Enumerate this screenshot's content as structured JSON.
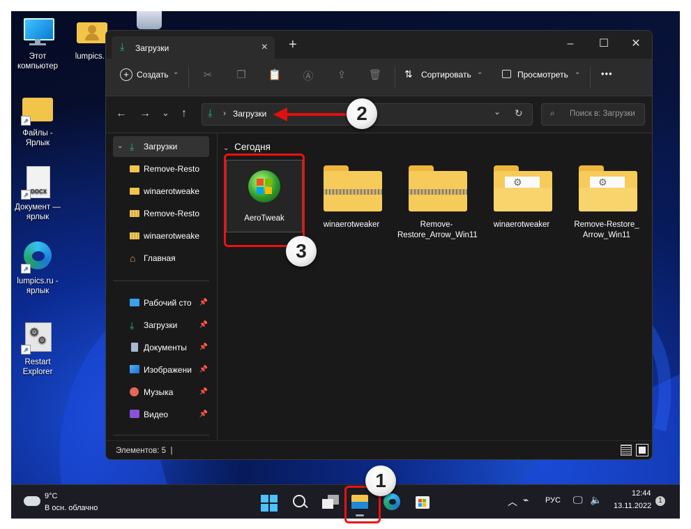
{
  "desktop": {
    "icons": [
      {
        "label": "Этот компьютер"
      },
      {
        "label": "lumpics..."
      },
      {
        "label": "Файлы - Ярлык"
      },
      {
        "label": "Документ — ярлык"
      },
      {
        "label": "lumpics.ru - ярлык"
      },
      {
        "label": "Restart Explorer"
      }
    ]
  },
  "window": {
    "tab_title": "Загрузки",
    "toolbar": {
      "create": "Создать",
      "sort": "Сортировать",
      "view": "Просмотреть",
      "more": "•••"
    },
    "address": {
      "path": "Загрузки",
      "search_placeholder": "Поиск в: Загрузки"
    },
    "sidebar": {
      "tree": [
        {
          "label": "Загрузки"
        },
        {
          "label": "Remove-Resto"
        },
        {
          "label": "winaerotweake"
        },
        {
          "label": "Remove-Resto"
        },
        {
          "label": "winaerotweake"
        },
        {
          "label": "Главная"
        }
      ],
      "pinned": [
        {
          "label": "Рабочий сто"
        },
        {
          "label": "Загрузки"
        },
        {
          "label": "Документы"
        },
        {
          "label": "Изображени"
        },
        {
          "label": "Музыка"
        },
        {
          "label": "Видео"
        }
      ]
    },
    "content": {
      "group": "Сегодня",
      "files": [
        {
          "name": "AeroTweak",
          "kind": "app"
        },
        {
          "name": "winaerotweaker",
          "kind": "zip"
        },
        {
          "name": "Remove-Restore_Arrow_Win11",
          "kind": "zip"
        },
        {
          "name": "winaerotweaker",
          "kind": "folder"
        },
        {
          "name": "Remove-Restore_Arrow_Win11",
          "kind": "folder"
        }
      ]
    },
    "status": "Элементов: 5  |"
  },
  "taskbar": {
    "weather_temp": "9°C",
    "weather_desc": "В осн. облачно",
    "lang": "РУС",
    "time": "12:44",
    "date": "13.11.2022",
    "notifications": "1"
  },
  "annotations": {
    "badge1": "1",
    "badge2": "2",
    "badge3": "3",
    "accent": "#e01010"
  }
}
